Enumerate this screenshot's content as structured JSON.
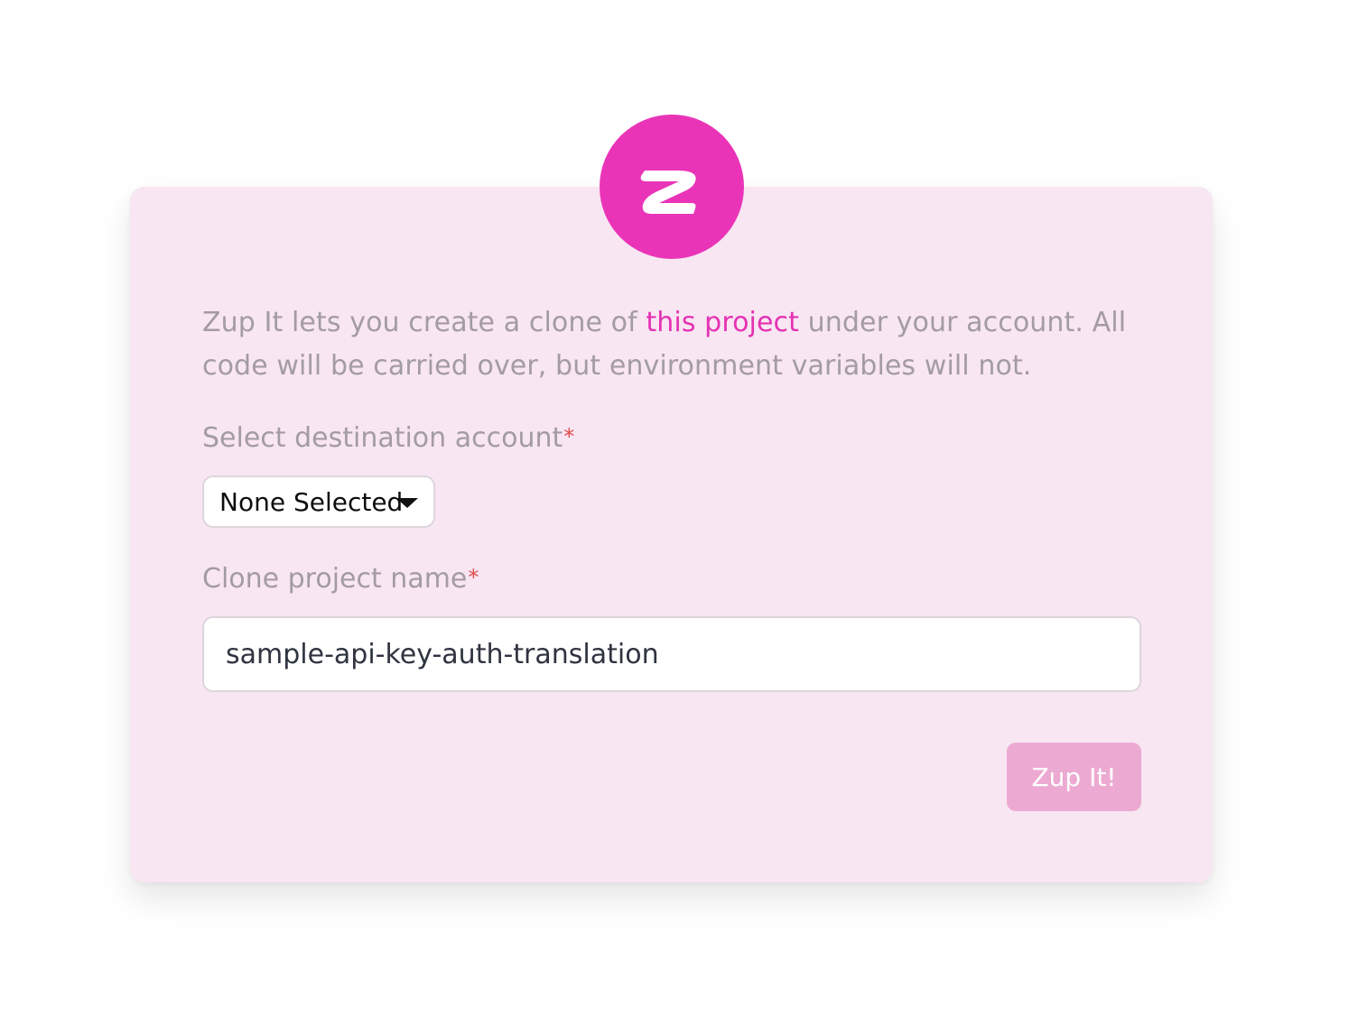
{
  "logo": {
    "icon": "zuplo-z-logo-icon",
    "color": "#ea34b8"
  },
  "description": {
    "before_link": "Zup It lets you create a clone of ",
    "link_text": "this project",
    "after_link": " under your account. All code will be carried over, but environment variables will not."
  },
  "account_field": {
    "label": "Select destination account",
    "required_marker": "*",
    "selected_value": "None Selected",
    "caret_icon": "chevron-down-icon"
  },
  "name_field": {
    "label": "Clone project name",
    "required_marker": "*",
    "value": "sample-api-key-auth-translation"
  },
  "submit": {
    "label": "Zup It!"
  },
  "colors": {
    "card_background": "#f8e6f2",
    "accent": "#e531b3",
    "button_disabled": "#ecaad2",
    "required": "#e24b4b"
  }
}
